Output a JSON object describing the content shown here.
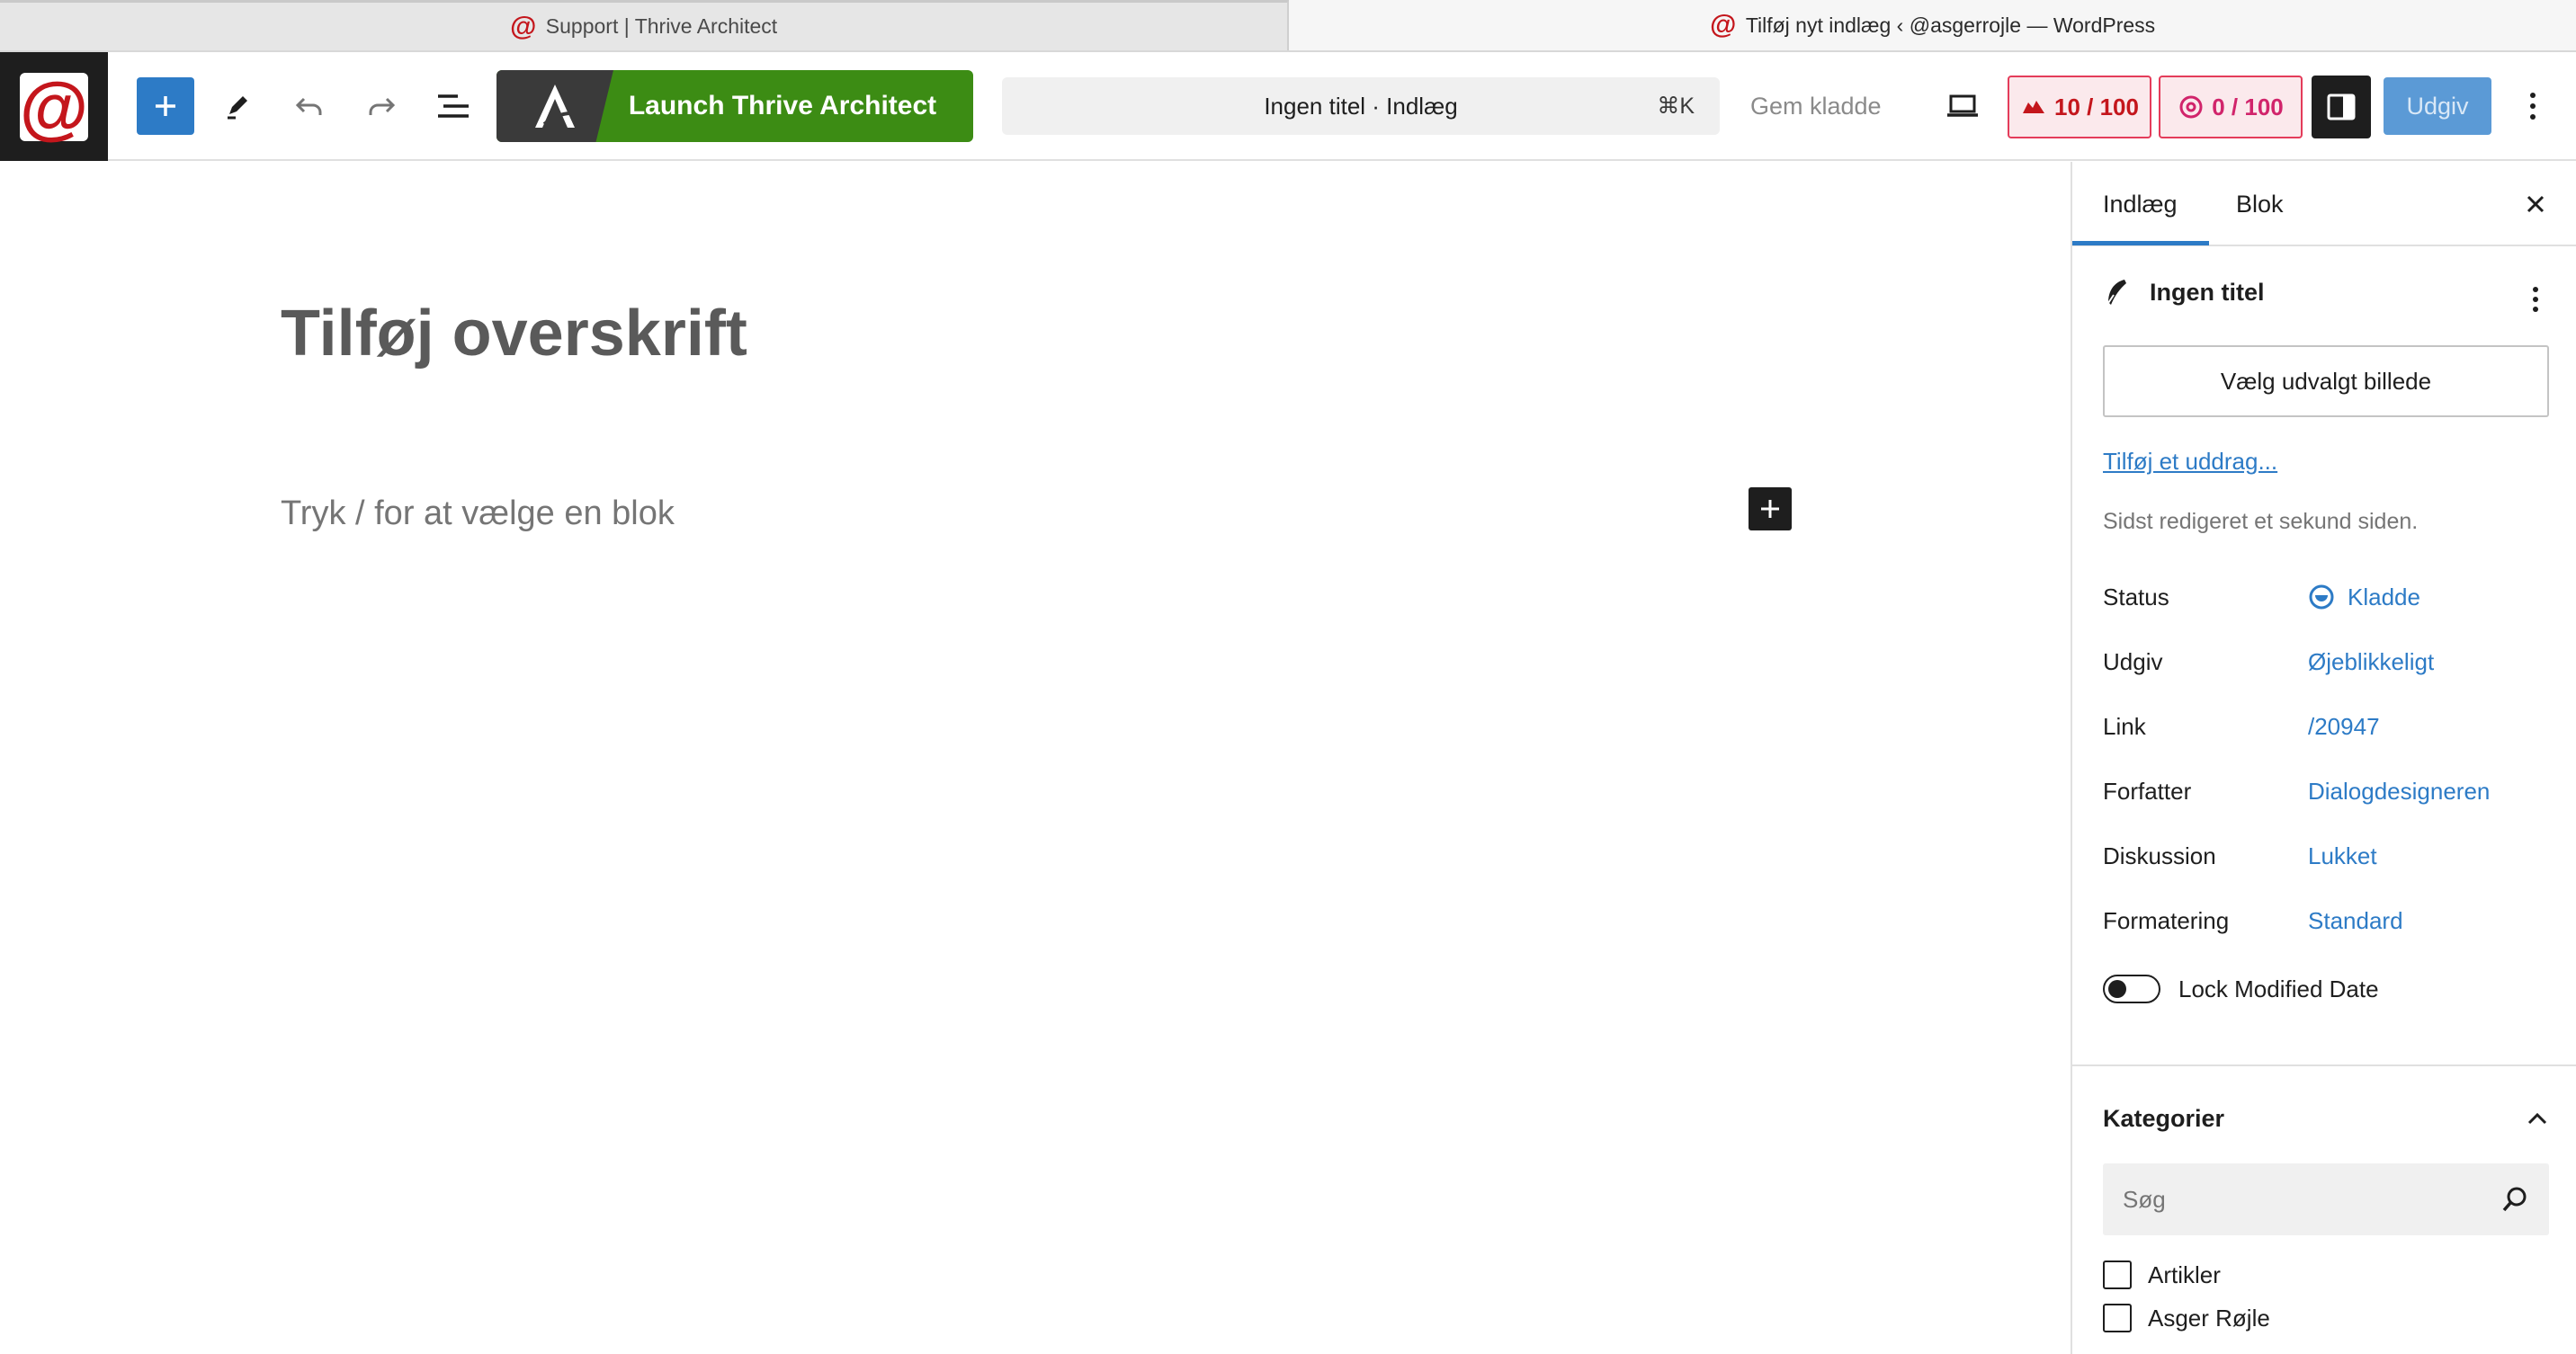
{
  "browser": {
    "tabs": [
      {
        "title": "Support | Thrive Architect",
        "active": false,
        "favicon": "at-sign-red"
      },
      {
        "title": "Tilføj nyt indlæg ‹ @asgerrojle — WordPress",
        "active": true,
        "favicon": "at-sign-red"
      }
    ]
  },
  "toolbar": {
    "site_logo_glyph": "@",
    "thrive_label": "Launch Thrive Architect",
    "doc_title": "Ingen titel · Indlæg",
    "shortcut": "⌘K",
    "save_draft": "Gem kladde",
    "score1": "10 / 100",
    "score2": "0 / 100",
    "publish": "Udgiv",
    "colors": {
      "accent": "#2d7bc6",
      "thrive_green": "#3c8c14",
      "score_red": "#c4161c",
      "score_pink": "#d1246b"
    }
  },
  "editor": {
    "title_placeholder": "Tilføj overskrift",
    "paragraph_placeholder": "Tryk / for at vælge en blok"
  },
  "sidebar": {
    "tabs": [
      "Indlæg",
      "Blok"
    ],
    "active_tab": "Indlæg",
    "post_title": "Ingen titel",
    "featured_image_button": "Vælg udvalgt billede",
    "excerpt_link": "Tilføj et uddrag...",
    "last_edited": "Sidst redigeret et sekund siden.",
    "meta": [
      {
        "label": "Status",
        "value": "Kladde"
      },
      {
        "label": "Udgiv",
        "value": "Øjeblikkeligt"
      },
      {
        "label": "Link",
        "value": "/20947"
      },
      {
        "label": "Forfatter",
        "value": "Dialogdesigneren"
      },
      {
        "label": "Diskussion",
        "value": "Lukket"
      },
      {
        "label": "Formatering",
        "value": "Standard"
      }
    ],
    "lock_modified_date": {
      "label": "Lock Modified Date",
      "enabled": false
    },
    "categories": {
      "heading": "Kategorier",
      "search_placeholder": "Søg",
      "items": [
        {
          "label": "Artikler",
          "checked": false
        },
        {
          "label": "Asger Røjle",
          "checked": false
        }
      ]
    }
  }
}
